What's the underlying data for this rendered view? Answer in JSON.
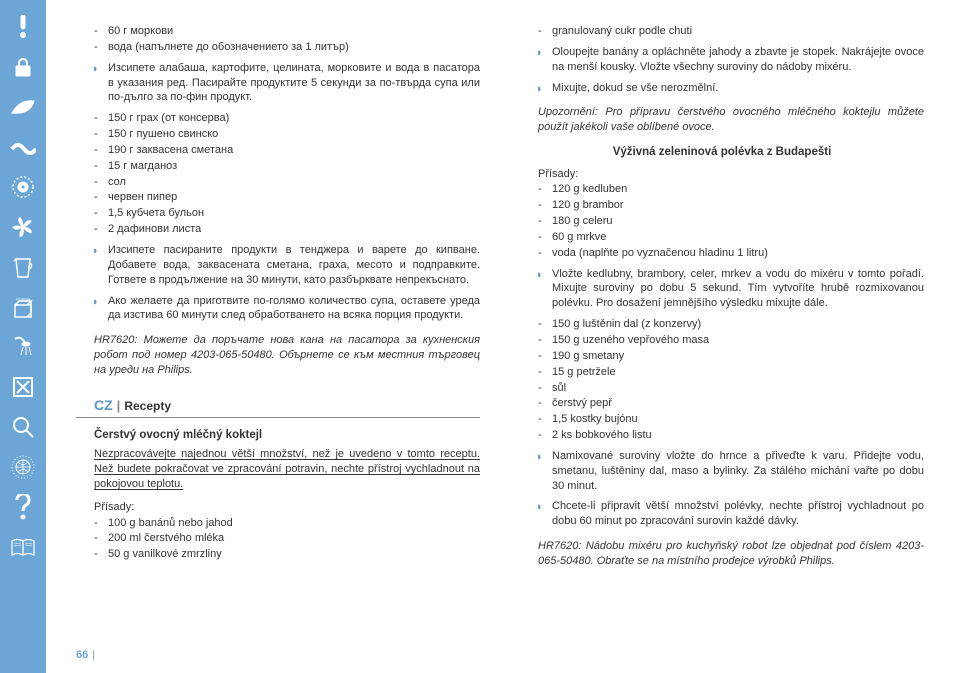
{
  "page_number": "66",
  "left_column": {
    "ingredients_top": [
      "60 г моркови",
      "вода (напълнете до обозначението за 1 литър)"
    ],
    "step1": "Изсипете алабаша, картофите, целината, морковите и вода в пасатора в указания ред. Пасирайте продуктите 5 секунди за по-твърда супа или по-дълго за по-фин продукт.",
    "ingredients_mid": [
      "150 г грах (от консерва)",
      "150 г пушено свинско",
      "190 г заквасена сметана",
      "15 г магданоз",
      "сол",
      "червен пипер",
      "1,5 кубчета бульон",
      "2 дафинови листа"
    ],
    "step2": "Изсипете пасираните продукти в тенджера и варете до кипване. Добавете вода, заквасената сметана, граха, месото и подправките. Гответе в продължение на 30 минути, като разбърквате непрекъснато.",
    "step3": "Ако желаете да приготвите по-голямо количество супа, оставете уреда да изстива 60 минути след обработването на всяка порция продукти.",
    "note1": "HR7620: Можете да поръчате нова кана на пасатора за кухненския робот под номер 4203-065-50480. Обърнете се към местния търговец на уреди на Philips.",
    "lang": "CZ",
    "section_title": "Recepty",
    "recipe1_title": "Čerstvý ovocný mléčný koktejl",
    "recipe1_intro": "Nezpracovávejte najednou větší množství, než je uvedeno v tomto receptu. Než budete pokračovat ve zpracování potravin, nechte přístroj vychladnout na pokojovou teplotu.",
    "recipe1_sub": "Přísady:",
    "recipe1_ing": [
      "100 g banánů nebo jahod",
      "200 ml čerstvého mléka",
      "50 g vanilkové zmrzliny"
    ]
  },
  "right_column": {
    "cont_ing": [
      "granulovaný cukr podle chuti"
    ],
    "step_a": "Oloupejte banány a opláchněte jahody a zbavte je stopek. Nakrájejte ovoce na menší kousky. Vložte všechny suroviny do nádoby mixéru.",
    "step_b": "Mixujte, dokud se vše nerozmělní.",
    "note_a": "Upozornění: Pro přípravu čerstvého ovocného mléčného koktejlu můžete použít jakékoli vaše oblíbené ovoce.",
    "recipe2_title": "Výživná zeleninová polévka z Budapešti",
    "recipe2_sub": "Přísady:",
    "recipe2_ing1": [
      "120 g kedluben",
      "120 g brambor",
      "180 g celeru",
      "60 g mrkve",
      "voda (naplňte po vyznačenou hladinu 1 litru)"
    ],
    "step_c": "Vložte kedlubny, brambory, celer, mrkev a vodu do mixéru v tomto pořadí. Mixujte suroviny po dobu 5 sekund. Tím vytvoříte hrubě rozmixovanou polévku. Pro dosažení jemnějšího výsledku mixujte dále.",
    "recipe2_ing2": [
      "150 g luštěnin dal (z konzervy)",
      "150 g uzeného vepřového masa",
      "190 g smetany",
      "15 g petržele",
      "sůl",
      "čerstvý pepř",
      "1,5 kostky bujónu",
      "2 ks bobkového listu"
    ],
    "step_d": "Namixované suroviny vložte do hrnce a přiveďte k varu. Přidejte vodu, smetanu, luštěniny dal, maso a bylinky. Za stálého míchání vařte po dobu 30 minut.",
    "step_e": "Chcete-li připravit větší množství polévky, nechte přístroj vychladnout po dobu 60 minut po zpracování surovin každé dávky.",
    "note_b": "HR7620: Nádobu mixéru pro kuchyňský robot lze objednat pod číslem 4203-065-50480. Obraťte se na místního prodejce výrobků Philips."
  },
  "icons": [
    "exclaim",
    "lock",
    "leaf",
    "wave",
    "record",
    "fan",
    "jug",
    "storage",
    "shower",
    "xbox",
    "magnify",
    "globe",
    "question",
    "book"
  ]
}
